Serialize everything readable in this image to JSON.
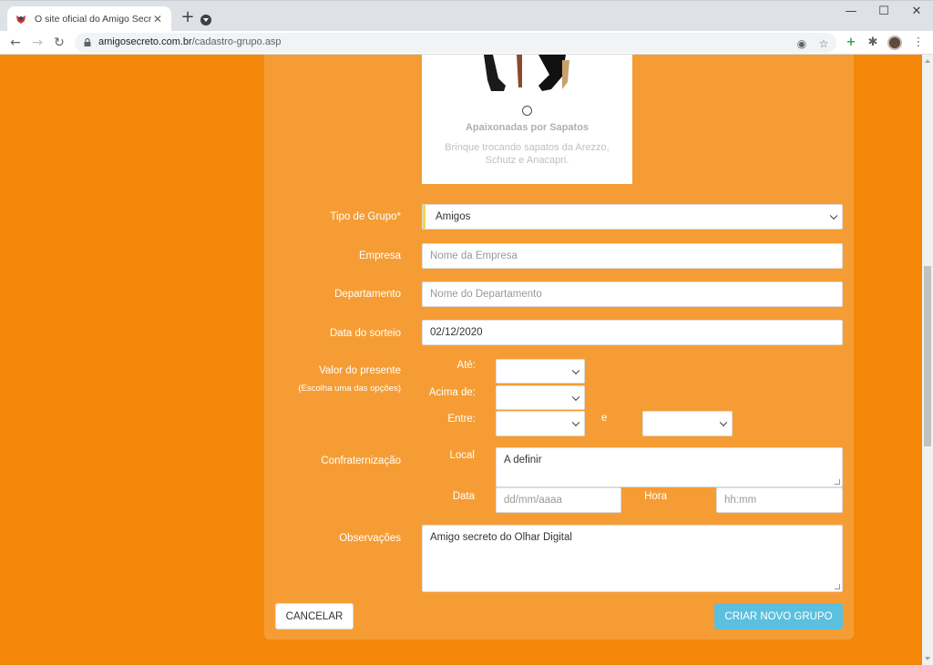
{
  "browser": {
    "tab_title": "O site oficial do Amigo Secreto",
    "tab_close": "✕",
    "new_tab": "+",
    "url_host": "amigosecreto.com.br",
    "url_path": "/cadastro-grupo.asp",
    "window_controls": {
      "minimize": "—",
      "maximize": "☐",
      "close": "✕"
    },
    "nav": {
      "back": "←",
      "forward": "→",
      "reload": "↻"
    }
  },
  "theme_option": {
    "title": "Apaixonadas por Sapatos",
    "description": "Brinque trocando sapatos da Arezzo, Schutz e Anacapri."
  },
  "form": {
    "tipo_grupo": {
      "label": "Tipo de Grupo*",
      "value": "Amigos"
    },
    "empresa": {
      "label": "Empresa",
      "placeholder": "Nome da Empresa"
    },
    "departamento": {
      "label": "Departamento",
      "placeholder": "Nome do Departamento"
    },
    "data_sorteio": {
      "label": "Data do sorteio",
      "value": "02/12/2020"
    },
    "valor_presente": {
      "label": "Valor do presente",
      "hint": "(Escolha uma das opções)",
      "ate_label": "Até:",
      "acima_label": "Acima de:",
      "entre_label": "Entre:",
      "e_label": "e"
    },
    "confraternizacao": {
      "label": "Confraternização",
      "local_label": "Local",
      "local_value": "A definir",
      "data_label": "Data",
      "data_placeholder": "dd/mm/aaaa",
      "hora_label": "Hora",
      "hora_placeholder": "hh:mm"
    },
    "observacoes": {
      "label": "Observações",
      "value": "Amigo secreto do Olhar Digital"
    }
  },
  "buttons": {
    "cancel": "CANCELAR",
    "create": "CRIAR NOVO GRUPO"
  },
  "colors": {
    "page_bg": "#f4870a",
    "panel_bg": "#f59d34",
    "create_button": "#5bc0de"
  }
}
